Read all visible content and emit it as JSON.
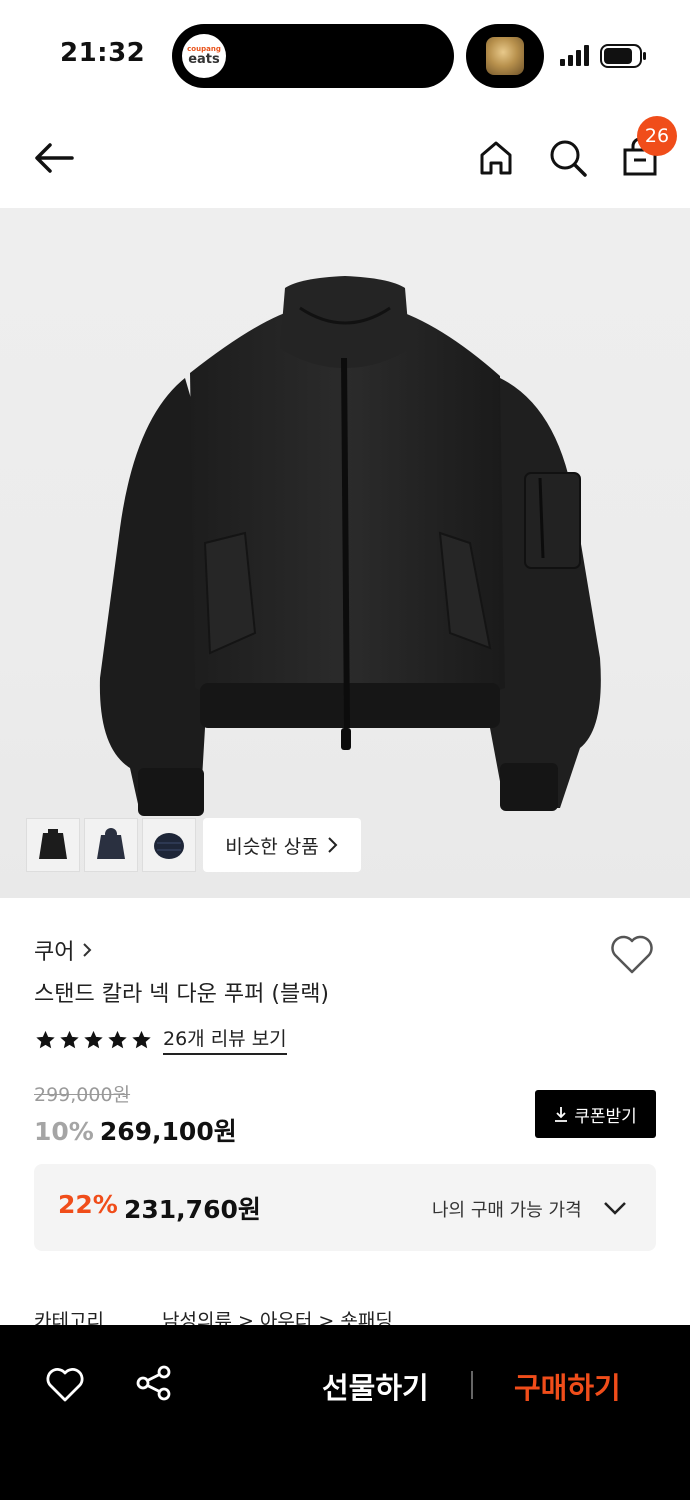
{
  "status_bar": {
    "time": "21:32",
    "island_app_brand": "coupang",
    "island_app_name": "eats"
  },
  "nav": {
    "cart_count": "26"
  },
  "gallery": {
    "similar_products_label": "비슷한 상품",
    "thumbnails": [
      "black-jacket",
      "navy-hooded-jacket",
      "navy-puffer"
    ]
  },
  "product": {
    "brand": "쿠어",
    "name": "스탠드 칼라 넥 다운 푸퍼 (블랙)",
    "rating_stars": 5,
    "review_link": "26개 리뷰 보기",
    "original_price": "299,000원",
    "discount_rate": "10%",
    "sale_price": "269,100원",
    "coupon_button": "쿠폰받기"
  },
  "best_price": {
    "discount_rate": "22%",
    "price": "231,760원",
    "label": "나의 구매 가능 가격"
  },
  "category": {
    "label": "카테고리",
    "path": "남성의류 > 아우터 > 숏패딩"
  },
  "bottom_bar": {
    "gift_label": "선물하기",
    "buy_label": "구매하기"
  },
  "colors": {
    "accent": "#f04d1a",
    "bottom_bar_bg": "#000000",
    "best_price_bg": "#f4f4f4"
  }
}
